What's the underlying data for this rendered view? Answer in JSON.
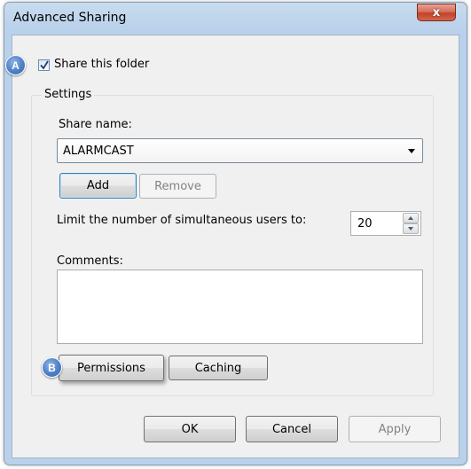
{
  "window": {
    "title": "Advanced Sharing",
    "close_symbol": "x"
  },
  "callouts": {
    "a": "A",
    "b": "B"
  },
  "share_checkbox": {
    "label": "Share this folder",
    "checked": true
  },
  "settings": {
    "group_title": "Settings",
    "share_name_label": "Share name:",
    "share_name_value": "ALARMCAST",
    "add_label": "Add",
    "remove_label": "Remove",
    "limit_label": "Limit the number of simultaneous users to:",
    "limit_value": "20",
    "comments_label": "Comments:",
    "comments_value": "",
    "permissions_label": "Permissions",
    "caching_label": "Caching"
  },
  "footer": {
    "ok_label": "OK",
    "cancel_label": "Cancel",
    "apply_label": "Apply"
  },
  "colors": {
    "callout": "#4d7fc7",
    "frame": "#b9d1ea",
    "close": "#c2432c"
  }
}
